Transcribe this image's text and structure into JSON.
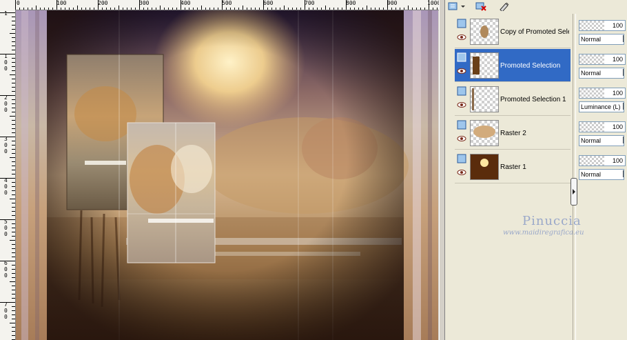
{
  "ruler": {
    "top_labels": [
      "0",
      "100",
      "200",
      "300",
      "400",
      "500",
      "600",
      "700",
      "800",
      "900",
      "1000"
    ],
    "left_labels": [
      "1",
      "100",
      "200",
      "300",
      "400",
      "500",
      "600",
      "700"
    ]
  },
  "toolbar": {
    "icons": [
      "new-layer-icon",
      "delete-layer-icon",
      "edit-layer-icon"
    ]
  },
  "layers": [
    {
      "name": "Copy of Promoted Selec",
      "opacity": "100",
      "blend": "Normal",
      "selected": false
    },
    {
      "name": "Promoted Selection",
      "opacity": "100",
      "blend": "Normal",
      "selected": true
    },
    {
      "name": "Promoted Selection 1",
      "opacity": "100",
      "blend": "Luminance (L)",
      "selected": false
    },
    {
      "name": "Raster 2",
      "opacity": "100",
      "blend": "Normal",
      "selected": false
    },
    {
      "name": "Raster 1",
      "opacity": "100",
      "blend": "Normal",
      "selected": false
    }
  ],
  "watermark": {
    "name": "Pinuccia",
    "url": "www.maidiregrafica.eu"
  },
  "colors": {
    "selection": "#316ac5",
    "canvas_sky_dark": "#2a1c3f",
    "canvas_sun": "#f7dba0",
    "canvas_ground": "#6e4a26"
  }
}
